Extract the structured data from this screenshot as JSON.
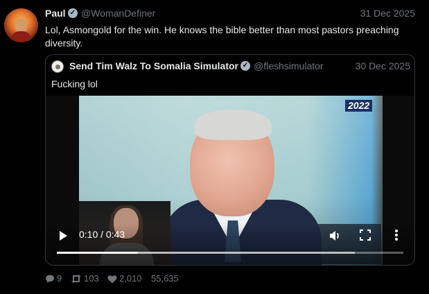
{
  "tweet": {
    "author_name": "Paul",
    "author_handle": "@WomanDefiner",
    "date": "31 Dec 2025",
    "text": "Lol, Asmongold for the win. He knows the bible better than most pastors preaching diversity.",
    "avatar_icon": "avatar-icon"
  },
  "quote": {
    "author_name": "Send Tim Walz To Somalia Simulator",
    "author_handle": "@fleshsimulator",
    "date": "30 Dec 2025",
    "text": "Fucking lol"
  },
  "video": {
    "year_badge": "2022",
    "time_display": "0:10 / 0:43",
    "progress_fraction": 0.233,
    "buffer_fraction": 0.86,
    "icons": [
      "play-icon",
      "volume-icon",
      "fullscreen-icon",
      "more-icon"
    ]
  },
  "actions": {
    "replies": "9",
    "retweets": "103",
    "likes": "2,010",
    "views": "55,635"
  },
  "colors": {
    "background": "#000000",
    "text_primary": "#e7e9ea",
    "text_secondary": "#71767b",
    "border": "#333639"
  }
}
